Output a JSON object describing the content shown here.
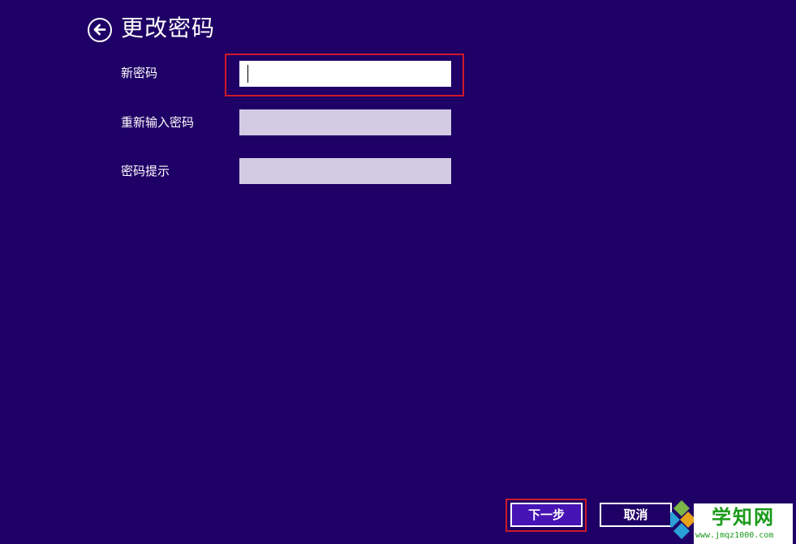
{
  "page": {
    "title": "更改密码"
  },
  "form": {
    "new_password": {
      "label": "新密码",
      "value": ""
    },
    "confirm_password": {
      "label": "重新输入密码",
      "value": ""
    },
    "password_hint": {
      "label": "密码提示",
      "value": ""
    }
  },
  "buttons": {
    "next_label": "下一步",
    "cancel_label": "取消"
  },
  "watermark": {
    "title": "学知网",
    "url": "www.jmqz1000.com"
  },
  "icons": {
    "back": "back-arrow-icon",
    "watermark_logo": "windows-logo-icon"
  },
  "colors": {
    "background": "#1f0066",
    "active_input": "#ffffff",
    "inactive_input": "#d3cbe3",
    "primary_button": "#4613b4",
    "highlight": "#cc1a2a",
    "watermark_text": "#1a9a1a"
  }
}
